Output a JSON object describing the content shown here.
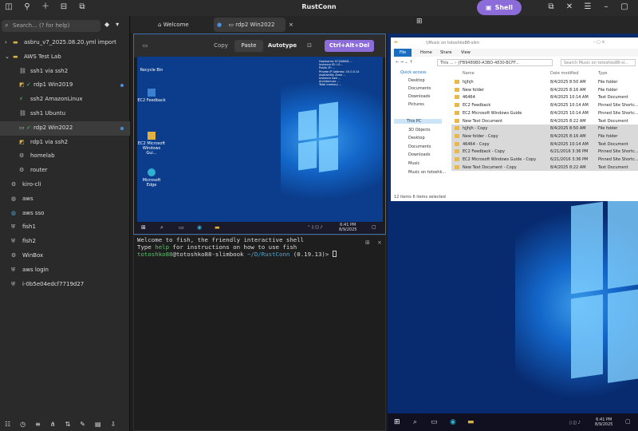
{
  "header": {
    "title": "RustConn",
    "shell_label": "Shell"
  },
  "sidebar": {
    "search_placeholder": "Search... (? for help)",
    "items": [
      {
        "label": "asbru_v7_2025.08.20.yml import",
        "icon": "chevron-right"
      },
      {
        "label": "AWS Test Lab",
        "icon": "chevron-down"
      },
      {
        "label": "ssh1 via ssh2",
        "icon": "link"
      },
      {
        "label": "rdp1 Win2019",
        "icon": "check"
      },
      {
        "label": "ssh2 AmazonLinux",
        "icon": "link"
      },
      {
        "label": "ssh1 Ubuntu",
        "icon": "link"
      },
      {
        "label": "rdp2 Win2022",
        "icon": "check"
      },
      {
        "label": "rdp1 via ssh2",
        "icon": "link"
      },
      {
        "label": "homelab",
        "icon": "gear"
      },
      {
        "label": "router",
        "icon": "gear"
      },
      {
        "label": "kiro-cli",
        "icon": "gear"
      },
      {
        "label": "aws",
        "icon": "globe"
      },
      {
        "label": "aws sso",
        "icon": "globe"
      },
      {
        "label": "fish1",
        "icon": "shield"
      },
      {
        "label": "fish2",
        "icon": "shield"
      },
      {
        "label": "WinBox",
        "icon": "gear"
      },
      {
        "label": "aws login",
        "icon": "shield"
      },
      {
        "label": "i-0b5e04edcf7719d27",
        "icon": "shield"
      }
    ]
  },
  "tabs": [
    {
      "label": "Welcome"
    },
    {
      "label": "rdp2 Win2022"
    }
  ],
  "rdp_toolbar": {
    "copy": "Copy",
    "paste": "Paste",
    "autotype": "Autotype",
    "ctrl_alt_del": "Ctrl+Alt+Del"
  },
  "remote_desktop": {
    "icons": [
      "Recycle Bin",
      "EC2 Feedback",
      "EC2 Microsoft Windows Gui...",
      "Microsoft Edge"
    ],
    "time": "6:41 PM",
    "date": "8/9/2025"
  },
  "terminal": {
    "line1": "Welcome to fish, the friendly interactive shell",
    "line2_a": "Type ",
    "line2_help": "help",
    "line2_b": " for instructions on how to use fish",
    "user": "totoshko88",
    "host": "@totoshko88-slimbook",
    "path": " ~/D/RustConn",
    "rest": " (0.19.13)> "
  },
  "explorer": {
    "title": "\\\\Music on totoshko88-slim",
    "menu": [
      "File",
      "Home",
      "Share",
      "View"
    ],
    "address": "This ... › {FB9489B0-A3BD-4830-BCFF...",
    "search": "Search Music on totoshko88-sl...",
    "nav": [
      "Quick access",
      "Desktop",
      "Documents",
      "Downloads",
      "Pictures",
      "This PC",
      "3D Objects",
      "Desktop",
      "Documents",
      "Downloads",
      "Music",
      "Music on totoshk..."
    ],
    "headers": [
      "Name",
      "Date modified",
      "Type"
    ],
    "rows": [
      {
        "name": "hjjhjh",
        "date": "8/4/2025 8:50 AM",
        "type": "File folder",
        "sel": false
      },
      {
        "name": "New folder",
        "date": "8/4/2025 8:16 AM",
        "type": "File folder",
        "sel": false
      },
      {
        "name": "46464",
        "date": "8/4/2025 10:14 AM",
        "type": "Text Document",
        "sel": false
      },
      {
        "name": "EC2 Feedback",
        "date": "8/4/2025 10:14 AM",
        "type": "Pinned Site Shortc...",
        "sel": false
      },
      {
        "name": "EC2 Microsoft Windows Guide",
        "date": "8/4/2025 10:14 AM",
        "type": "Pinned Site Shortc...",
        "sel": false
      },
      {
        "name": "New Text Document",
        "date": "8/4/2025 8:22 AM",
        "type": "Text Document",
        "sel": false
      },
      {
        "name": "hjjhjh - Copy",
        "date": "8/4/2025 8:50 AM",
        "type": "File folder",
        "sel": true
      },
      {
        "name": "New folder - Copy",
        "date": "8/4/2025 8:16 AM",
        "type": "File folder",
        "sel": true
      },
      {
        "name": "46464 - Copy",
        "date": "8/4/2025 10:14 AM",
        "type": "Text Document",
        "sel": true
      },
      {
        "name": "EC2 Feedback - Copy",
        "date": "6/21/2016 3:36 PM",
        "type": "Pinned Site Shortc...",
        "sel": true
      },
      {
        "name": "EC2 Microsoft Windows Guide - Copy",
        "date": "6/21/2016 3:36 PM",
        "type": "Pinned Site Shortc...",
        "sel": true
      },
      {
        "name": "New Text Document - Copy",
        "date": "8/4/2025 8:22 AM",
        "type": "Text Document",
        "sel": true
      }
    ],
    "status": "12 items    6 items selected"
  },
  "remote_desktop2": {
    "time": "6:41 PM",
    "date": "8/9/2025"
  },
  "colors": {
    "accent": "#8c6cd8",
    "selection": "#3c3c3c",
    "active_dot": "#4a8fe0",
    "fish_green": "#58c46c",
    "path_blue": "#4aa8d8"
  }
}
